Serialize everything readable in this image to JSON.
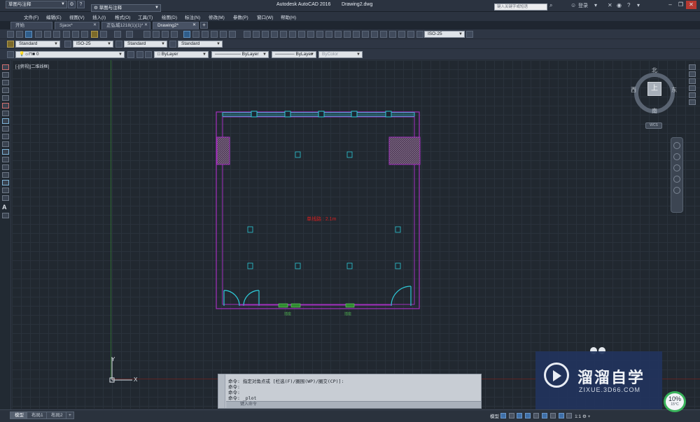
{
  "titlebar": {
    "workspace_quick": "草图与注释",
    "workspace_menu": "草图与注释",
    "app_name": "Autodesk AutoCAD 2016",
    "document": "Drawing2.dwg",
    "search_placeholder": "键入关键字或短语",
    "login": "登录"
  },
  "menu": {
    "items": [
      "文件(F)",
      "编辑(E)",
      "视图(V)",
      "插入(I)",
      "格式(O)",
      "工具(T)",
      "绘图(D)",
      "标注(N)",
      "修改(M)",
      "参数(P)",
      "窗口(W)",
      "帮助(H)"
    ]
  },
  "tabs": [
    {
      "label": "开始"
    },
    {
      "label": "Sjaox*"
    },
    {
      "label": "正弘城1218(1)(1)*"
    },
    {
      "label": "Drawing2*"
    }
  ],
  "styles_row": {
    "text_style": "Standard",
    "dim_style": "ISO-25",
    "table_style": "Standard",
    "mleader_style": "Standard",
    "dim_style_right": "ISO-25"
  },
  "layers_row": {
    "layer": "0",
    "color": "ByLayer",
    "linetype": "ByLayer",
    "lineweight": "ByLayer",
    "plotstyle": "ByColor"
  },
  "viewport_label": "[-][俯视][二维线框]",
  "viewcube": {
    "top": "上",
    "north": "北",
    "south": "南",
    "east": "东",
    "west": "西",
    "wcs": "WCS"
  },
  "drawing": {
    "center_label": "单线路 : 2.1m",
    "label_left": "插座",
    "label_right": "插座",
    "fixture_caption": "插座"
  },
  "ucs": {
    "x": "X",
    "y": "Y"
  },
  "command": {
    "lines": [
      "命令: 指定对角点或 [栏选(F)/圈围(WP)/圈交(CP)]:",
      "命令:",
      "命令:",
      "命令: _plot"
    ],
    "input_placeholder": "键入命令"
  },
  "status": {
    "layout_tabs": [
      "模型",
      "布局1",
      "布局2"
    ],
    "model_label": "模型",
    "scale": "1:1"
  },
  "watermark": {
    "title": "溜溜自学",
    "url": "ZIXUE.3D66.COM"
  },
  "progress": {
    "percent": "10%",
    "sub": "15°C",
    "value": 0.1
  }
}
